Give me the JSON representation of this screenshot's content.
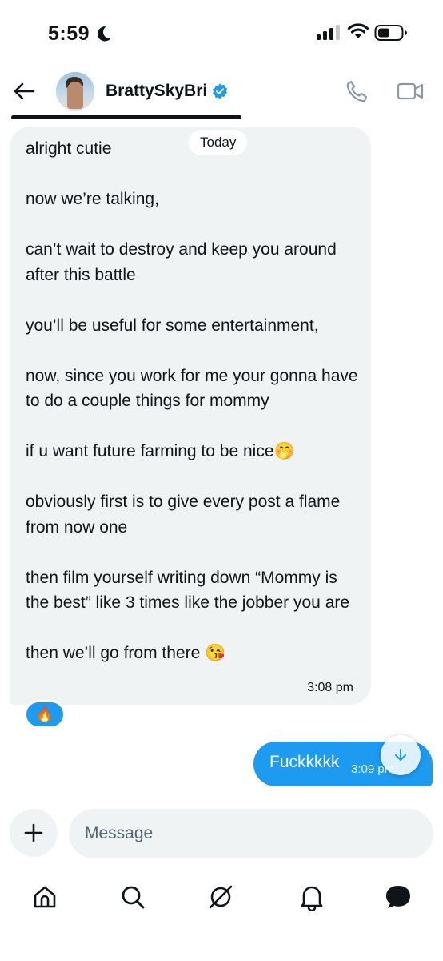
{
  "status_bar": {
    "time": "5:59"
  },
  "header": {
    "contact_name": "BrattySkyBri",
    "icons": [
      "back-arrow-icon",
      "verified-badge-icon",
      "phone-icon",
      "video-camera-icon"
    ]
  },
  "conversation": {
    "date_divider": "Today",
    "incoming": {
      "text": "alright cutie\n\nnow we’re talking,\n\ncan’t wait to destroy and keep you around after this battle\n\nyou’ll be useful for some entertainment,\n\nnow, since you work for me your gonna have to do a couple things for mommy\n\nif u want future farming to be nice🤭\n\nobviously first is to give every post a flame from now one\n\nthen film yourself writing down “Mommy is the best” like 3 times like the jobber you are\n\nthen we’ll go from there 😘",
      "time": "3:08 pm",
      "reaction": "🔥"
    },
    "outgoing": {
      "text": "Fuckkkkk",
      "time": "3:09 pm"
    }
  },
  "composer": {
    "placeholder": "Message"
  },
  "bottom_nav": {
    "items": [
      "home-icon",
      "search-icon",
      "grok-icon",
      "notifications-bell-icon",
      "messages-icon"
    ]
  },
  "colors": {
    "accent": "#1d9bf0",
    "bubble_incoming": "#eff3f4",
    "text_primary": "#0f1419",
    "text_secondary": "#536471"
  }
}
